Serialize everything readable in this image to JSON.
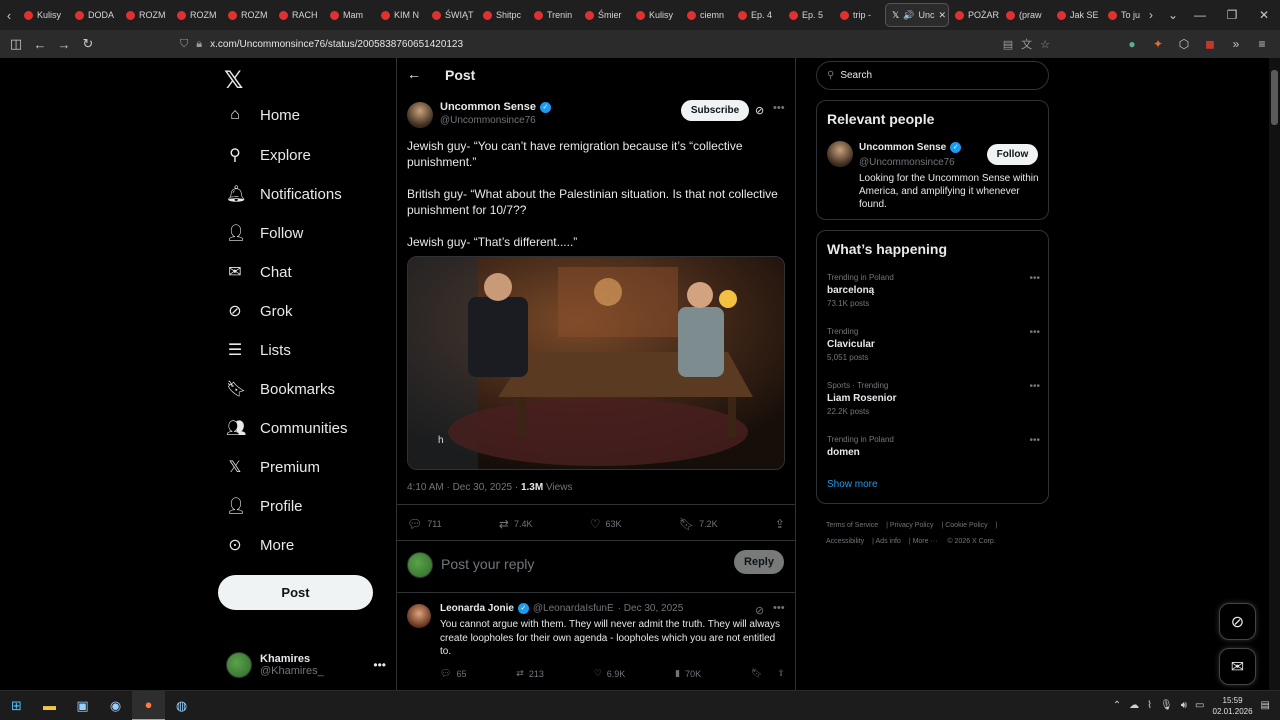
{
  "browser": {
    "tabs": [
      {
        "label": "Kulisy"
      },
      {
        "label": "DODA"
      },
      {
        "label": "ROZM"
      },
      {
        "label": "ROZM"
      },
      {
        "label": "ROZM"
      },
      {
        "label": "RACH"
      },
      {
        "label": "Mam"
      },
      {
        "label": "KIM N"
      },
      {
        "label": "ŚWIĄT"
      },
      {
        "label": "Shitpc"
      },
      {
        "label": "Trenin"
      },
      {
        "label": "Śmier"
      },
      {
        "label": "Kulisy"
      },
      {
        "label": "ciemn"
      },
      {
        "label": "Ep. 4"
      },
      {
        "label": "Ep. 5"
      },
      {
        "label": "trip -"
      },
      {
        "label": "Unc"
      },
      {
        "label": "POŻAR"
      },
      {
        "label": "(praw"
      },
      {
        "label": "Jak SE"
      },
      {
        "label": "To ju"
      }
    ],
    "url": "x.com/Uncommonsince76/status/2005838760651420123"
  },
  "nav": {
    "items": [
      {
        "label": "Home",
        "icon": "home-icon"
      },
      {
        "label": "Explore",
        "icon": "search-icon"
      },
      {
        "label": "Notifications",
        "icon": "bell-icon"
      },
      {
        "label": "Follow",
        "icon": "add-person-icon"
      },
      {
        "label": "Chat",
        "icon": "mail-icon"
      },
      {
        "label": "Grok",
        "icon": "grok-icon"
      },
      {
        "label": "Lists",
        "icon": "list-icon"
      },
      {
        "label": "Bookmarks",
        "icon": "bookmark-icon"
      },
      {
        "label": "Communities",
        "icon": "people-icon"
      },
      {
        "label": "Premium",
        "icon": "x-icon"
      },
      {
        "label": "Profile",
        "icon": "person-icon"
      },
      {
        "label": "More",
        "icon": "more-circle-icon"
      }
    ],
    "post_label": "Post",
    "me": {
      "name": "Khamires",
      "handle": "@Khamires_"
    }
  },
  "post": {
    "header_title": "Post",
    "author": {
      "name": "Uncommon Sense",
      "handle": "@Uncommonsince76"
    },
    "subscribe_label": "Subscribe",
    "text": [
      "Jewish guy- “You can’t have remigration because it’s “collective punishment.”",
      "British guy- “What about the Palestinian situation. Is that not collective punishment for 10/7??",
      "Jewish guy- “That’s different.....”"
    ],
    "media_caption": "h",
    "time": "4:10 AM · Dec 30, 2025 · ",
    "views_count": "1.3M",
    "views_label": " Views",
    "stats": {
      "replies": "711",
      "reposts": "7.4K",
      "likes": "63K",
      "bookmarks": "7.2K"
    },
    "reply_placeholder": "Post your reply",
    "reply_label": "Reply"
  },
  "comment": {
    "name": "Leonarda Jonie",
    "handle": "@LeonardaIsfunE",
    "date": "· Dec 30, 2025",
    "text": "You cannot argue with them. They will never admit the truth. They will always create loopholes for their own agenda - loopholes which you are not entitled to.",
    "stats": {
      "replies": "65",
      "reposts": "213",
      "likes": "6.9K",
      "views": "70K"
    }
  },
  "sidebar": {
    "search_placeholder": "Search",
    "relevant_title": "Relevant people",
    "person": {
      "name": "Uncommon Sense",
      "handle": "@Uncommonsince76",
      "bio": "Looking for the Uncommon Sense within America, and amplifying it whenever found.",
      "follow_label": "Follow"
    },
    "happening_title": "What’s happening",
    "trends": [
      {
        "context": "Trending in Poland",
        "title": "barceloną",
        "count": "73.1K posts"
      },
      {
        "context": "Trending",
        "title": "Clavicular",
        "count": "5,051 posts"
      },
      {
        "context": "Sports · Trending",
        "title": "Liam Rosenior",
        "count": "22.2K posts"
      },
      {
        "context": "Trending in Poland",
        "title": "domen",
        "count": ""
      }
    ],
    "show_more": "Show more",
    "footer": [
      "Terms of Service",
      "Privacy Policy",
      "Cookie Policy",
      "Accessibility",
      "Ads info",
      "More ···",
      "© 2026 X Corp."
    ]
  },
  "taskbar": {
    "time": "15:59",
    "date": "02.01.2026"
  },
  "colors": {
    "accent": "#1d9bf0",
    "bg": "#000000",
    "muted": "#71767b"
  }
}
